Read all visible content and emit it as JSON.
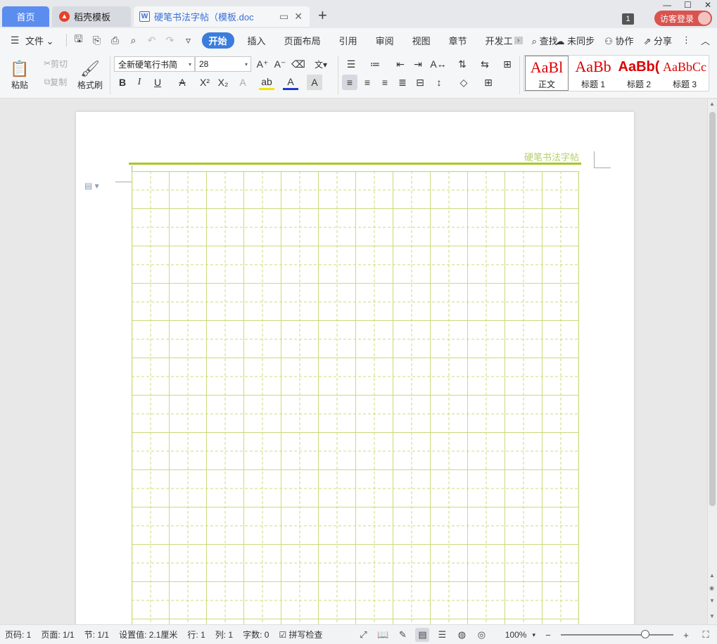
{
  "tabs": {
    "home": "首页",
    "daoke": "稻壳模板",
    "doc": "硬笔书法字帖（模板.doc"
  },
  "window": {
    "tab_count": "1",
    "login": "访客登录"
  },
  "menu": {
    "file": "文件",
    "items": [
      "开始",
      "插入",
      "页面布局",
      "引用",
      "审阅",
      "视图",
      "章节",
      "开发工"
    ],
    "search": "查找",
    "sync": "未同步",
    "collab": "协作",
    "share": "分享"
  },
  "ribbon": {
    "paste": "粘贴",
    "cut": "剪切",
    "copy": "复制",
    "format_painter": "格式刷",
    "font_name": "全新硬笔行书简",
    "font_size": "28",
    "styles": [
      {
        "preview": "AaBl",
        "label": "正文"
      },
      {
        "preview": "AaBb",
        "label": "标题 1"
      },
      {
        "preview": "AaBb(",
        "label": "标题 2"
      },
      {
        "preview": "AaBbCc",
        "label": "标题 3"
      }
    ]
  },
  "document": {
    "header_title": "硬笔书法字帖",
    "grid_color": "#c8dc7a",
    "line_color": "#a7c824"
  },
  "status": {
    "page_no": "页码: 1",
    "pages": "页面: 1/1",
    "section": "节: 1/1",
    "setting": "设置值: 2.1厘米",
    "row": "行: 1",
    "col": "列: 1",
    "words": "字数: 0",
    "spell": "拼写检查",
    "zoom": "100%",
    "zoom_level": 0.75
  }
}
